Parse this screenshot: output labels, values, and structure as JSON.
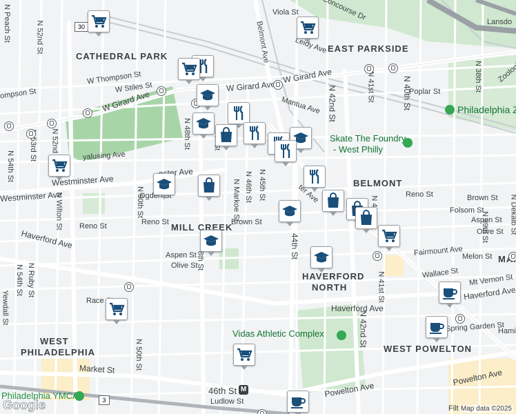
{
  "map": {
    "footer": "Map data ©2025",
    "logo": "Google",
    "neighborhoods": {
      "cathedral_park": "CATHEDRAL PARK",
      "east_parkside": "EAST PARKSIDE",
      "belmont": "BELMONT",
      "mill_creek": "MILL CREEK",
      "haverford_north_1": "HAVERFORD",
      "haverford_north_2": "NORTH",
      "west_philadelphia_1": "WEST",
      "west_philadelphia_2": "PHILADELPHIA",
      "west_powelton": "WEST POWELTON",
      "man": "MAN"
    },
    "pois": {
      "skate_1": "Skate The Foundry",
      "skate_2": "- West Philly",
      "vidas": "Vidas Athletic Complex",
      "philly_zoo": "Philadelphia Z",
      "ymca": "Philadelphia YMCA",
      "station": "46th St"
    },
    "streets": {
      "viola": "Viola St",
      "s_concourse": "S Concourse Dr",
      "lansdowne": "Lansdo",
      "leidy": "Leidy Ave",
      "belmont_ave": "Belmont Ave",
      "w_girard_1": "W Girard Ave",
      "w_girard_2": "W Girard Ave",
      "w_girard_3": "W Girard Ave",
      "w_thompson": "W Thompson St",
      "w_stiles": "W Stiles St",
      "thompson": "ompson St",
      "n_peach": "N Peach St",
      "n_52nd": "N 52nd St",
      "n_52nd_b": "N 52nd St",
      "n_53rd": "N 53rd St",
      "n_54th": "N 54th St",
      "n_50th": "N 50th St",
      "n_48th": "N 48th St",
      "n_48th_b": "8th St",
      "n_47th": "7th St",
      "n_markoe": "N Markoe St",
      "n_46th": "N 46th St",
      "n_45th": "N 45th St",
      "n_44th": "44th St",
      "n_42nd": "N 42nd St",
      "n_42nd_b": "N 42nd St",
      "n_41st": "N 41st St",
      "n_41st_b": "N 41st St",
      "n_40th": "N 40th St",
      "n_39th": "N 39th St",
      "n_38th": "N 38th St",
      "n_dekalb": "N Dekalb St",
      "n_wilton": "N Wilton St",
      "poplar": "Poplar St",
      "mantua": "Mantua Ave",
      "parkside": "Zoological",
      "westminster_1": "Westminster Ave",
      "westminster_2": "Westminster Ave",
      "westminster_3": "nster Ave",
      "wyalusing": "yalusing Ave",
      "ogden": "Ogden St",
      "reno_1": "Reno St",
      "reno_2": "Reno St",
      "reno_3": "Reno St",
      "brown_1": "Brown St",
      "brown_2": "Brown St",
      "folsom": "Folsom St",
      "aspen_1": "Aspen St",
      "aspen_2": "Aspen St",
      "olive_1": "Olive St",
      "olive_2": "Olive St",
      "haverford_1": "Haverford Ave",
      "haverford_2": "Haverford Ave",
      "haverford_3": "Haverford Ave",
      "fairmount": "Fairmount Ave",
      "melon": "Melon St",
      "wallace": "Wallace St",
      "mt_vernon": "Mt Vernon St",
      "race": "Race St",
      "spring_garden": "Spring Garden St",
      "market": "Market St",
      "powelton_1": "Powelton Ave",
      "powelton_2": "Powelton Ave",
      "ludlow": "Ludlow St",
      "n_54th_b": "N 54th St",
      "n_ruby": "N Ruby St",
      "n_yewdall": "Yewdall St",
      "n_50th_b": "N 50th St",
      "n_41st_c": "N 41st St",
      "hamilton": "Hamilt",
      "filt": "Filt",
      "lancaster": "ter Ave",
      "route_30": "30",
      "route_3": "3"
    }
  },
  "markers": [
    {
      "icon": "grocery-icon",
      "label": "grocery store"
    },
    {
      "icon": "grocery-icon",
      "label": "grocery store"
    },
    {
      "icon": "restaurant-icon",
      "label": "restaurant"
    },
    {
      "icon": "grocery-icon",
      "label": "grocery store"
    },
    {
      "icon": "school-icon",
      "label": "school"
    },
    {
      "icon": "restaurant-icon",
      "label": "restaurant"
    },
    {
      "icon": "school-icon",
      "label": "school"
    },
    {
      "icon": "shopping-icon",
      "label": "shopping"
    },
    {
      "icon": "restaurant-icon",
      "label": "restaurant"
    },
    {
      "icon": "restaurant-icon",
      "label": "restaurant"
    },
    {
      "icon": "school-icon",
      "label": "school"
    },
    {
      "icon": "grocery-icon",
      "label": "grocery store"
    },
    {
      "icon": "school-icon",
      "label": "school"
    },
    {
      "icon": "shopping-icon",
      "label": "shopping"
    },
    {
      "icon": "restaurant-icon",
      "label": "restaurant"
    },
    {
      "icon": "restaurant-icon",
      "label": "restaurant"
    },
    {
      "icon": "shopping-icon",
      "label": "shopping"
    },
    {
      "icon": "shopping-icon",
      "label": "shopping"
    },
    {
      "icon": "shopping-icon",
      "label": "shopping"
    },
    {
      "icon": "school-icon",
      "label": "school"
    },
    {
      "icon": "school-icon",
      "label": "school"
    },
    {
      "icon": "school-icon",
      "label": "school"
    },
    {
      "icon": "grocery-icon",
      "label": "grocery store"
    },
    {
      "icon": "cafe-icon",
      "label": "cafe"
    },
    {
      "icon": "grocery-icon",
      "label": "grocery store"
    },
    {
      "icon": "grocery-icon",
      "label": "grocery store"
    },
    {
      "icon": "cafe-icon",
      "label": "cafe"
    },
    {
      "icon": "cafe-icon",
      "label": "cafe"
    }
  ],
  "colors": {
    "marker": "#1a4f7a",
    "park": "#c8e6c9",
    "road": "#ffffff",
    "arterial": "#fde293"
  }
}
